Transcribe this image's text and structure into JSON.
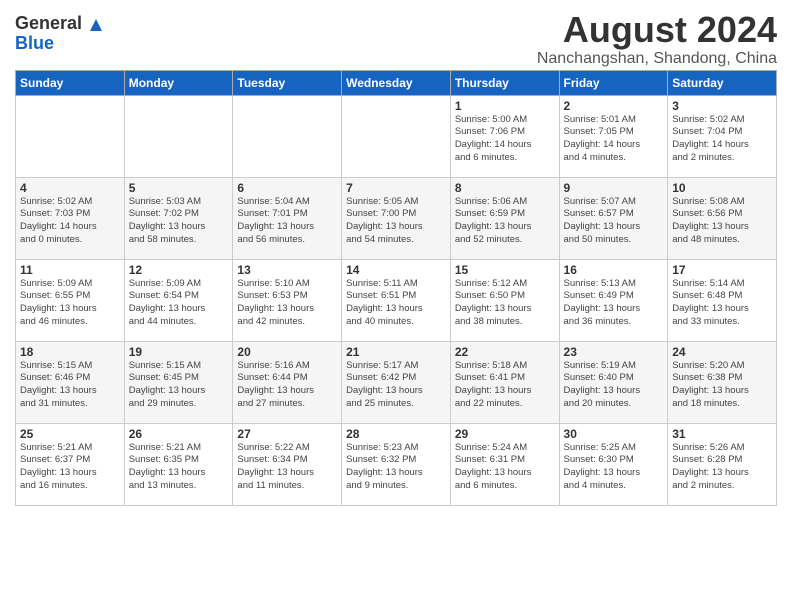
{
  "logo": {
    "general": "General",
    "blue": "Blue"
  },
  "title": "August 2024",
  "subtitle": "Nanchangshan, Shandong, China",
  "days_header": [
    "Sunday",
    "Monday",
    "Tuesday",
    "Wednesday",
    "Thursday",
    "Friday",
    "Saturday"
  ],
  "weeks": [
    [
      {
        "num": "",
        "info": ""
      },
      {
        "num": "",
        "info": ""
      },
      {
        "num": "",
        "info": ""
      },
      {
        "num": "",
        "info": ""
      },
      {
        "num": "1",
        "info": "Sunrise: 5:00 AM\nSunset: 7:06 PM\nDaylight: 14 hours\nand 6 minutes."
      },
      {
        "num": "2",
        "info": "Sunrise: 5:01 AM\nSunset: 7:05 PM\nDaylight: 14 hours\nand 4 minutes."
      },
      {
        "num": "3",
        "info": "Sunrise: 5:02 AM\nSunset: 7:04 PM\nDaylight: 14 hours\nand 2 minutes."
      }
    ],
    [
      {
        "num": "4",
        "info": "Sunrise: 5:02 AM\nSunset: 7:03 PM\nDaylight: 14 hours\nand 0 minutes."
      },
      {
        "num": "5",
        "info": "Sunrise: 5:03 AM\nSunset: 7:02 PM\nDaylight: 13 hours\nand 58 minutes."
      },
      {
        "num": "6",
        "info": "Sunrise: 5:04 AM\nSunset: 7:01 PM\nDaylight: 13 hours\nand 56 minutes."
      },
      {
        "num": "7",
        "info": "Sunrise: 5:05 AM\nSunset: 7:00 PM\nDaylight: 13 hours\nand 54 minutes."
      },
      {
        "num": "8",
        "info": "Sunrise: 5:06 AM\nSunset: 6:59 PM\nDaylight: 13 hours\nand 52 minutes."
      },
      {
        "num": "9",
        "info": "Sunrise: 5:07 AM\nSunset: 6:57 PM\nDaylight: 13 hours\nand 50 minutes."
      },
      {
        "num": "10",
        "info": "Sunrise: 5:08 AM\nSunset: 6:56 PM\nDaylight: 13 hours\nand 48 minutes."
      }
    ],
    [
      {
        "num": "11",
        "info": "Sunrise: 5:09 AM\nSunset: 6:55 PM\nDaylight: 13 hours\nand 46 minutes."
      },
      {
        "num": "12",
        "info": "Sunrise: 5:09 AM\nSunset: 6:54 PM\nDaylight: 13 hours\nand 44 minutes."
      },
      {
        "num": "13",
        "info": "Sunrise: 5:10 AM\nSunset: 6:53 PM\nDaylight: 13 hours\nand 42 minutes."
      },
      {
        "num": "14",
        "info": "Sunrise: 5:11 AM\nSunset: 6:51 PM\nDaylight: 13 hours\nand 40 minutes."
      },
      {
        "num": "15",
        "info": "Sunrise: 5:12 AM\nSunset: 6:50 PM\nDaylight: 13 hours\nand 38 minutes."
      },
      {
        "num": "16",
        "info": "Sunrise: 5:13 AM\nSunset: 6:49 PM\nDaylight: 13 hours\nand 36 minutes."
      },
      {
        "num": "17",
        "info": "Sunrise: 5:14 AM\nSunset: 6:48 PM\nDaylight: 13 hours\nand 33 minutes."
      }
    ],
    [
      {
        "num": "18",
        "info": "Sunrise: 5:15 AM\nSunset: 6:46 PM\nDaylight: 13 hours\nand 31 minutes."
      },
      {
        "num": "19",
        "info": "Sunrise: 5:15 AM\nSunset: 6:45 PM\nDaylight: 13 hours\nand 29 minutes."
      },
      {
        "num": "20",
        "info": "Sunrise: 5:16 AM\nSunset: 6:44 PM\nDaylight: 13 hours\nand 27 minutes."
      },
      {
        "num": "21",
        "info": "Sunrise: 5:17 AM\nSunset: 6:42 PM\nDaylight: 13 hours\nand 25 minutes."
      },
      {
        "num": "22",
        "info": "Sunrise: 5:18 AM\nSunset: 6:41 PM\nDaylight: 13 hours\nand 22 minutes."
      },
      {
        "num": "23",
        "info": "Sunrise: 5:19 AM\nSunset: 6:40 PM\nDaylight: 13 hours\nand 20 minutes."
      },
      {
        "num": "24",
        "info": "Sunrise: 5:20 AM\nSunset: 6:38 PM\nDaylight: 13 hours\nand 18 minutes."
      }
    ],
    [
      {
        "num": "25",
        "info": "Sunrise: 5:21 AM\nSunset: 6:37 PM\nDaylight: 13 hours\nand 16 minutes."
      },
      {
        "num": "26",
        "info": "Sunrise: 5:21 AM\nSunset: 6:35 PM\nDaylight: 13 hours\nand 13 minutes."
      },
      {
        "num": "27",
        "info": "Sunrise: 5:22 AM\nSunset: 6:34 PM\nDaylight: 13 hours\nand 11 minutes."
      },
      {
        "num": "28",
        "info": "Sunrise: 5:23 AM\nSunset: 6:32 PM\nDaylight: 13 hours\nand 9 minutes."
      },
      {
        "num": "29",
        "info": "Sunrise: 5:24 AM\nSunset: 6:31 PM\nDaylight: 13 hours\nand 6 minutes."
      },
      {
        "num": "30",
        "info": "Sunrise: 5:25 AM\nSunset: 6:30 PM\nDaylight: 13 hours\nand 4 minutes."
      },
      {
        "num": "31",
        "info": "Sunrise: 5:26 AM\nSunset: 6:28 PM\nDaylight: 13 hours\nand 2 minutes."
      }
    ]
  ]
}
